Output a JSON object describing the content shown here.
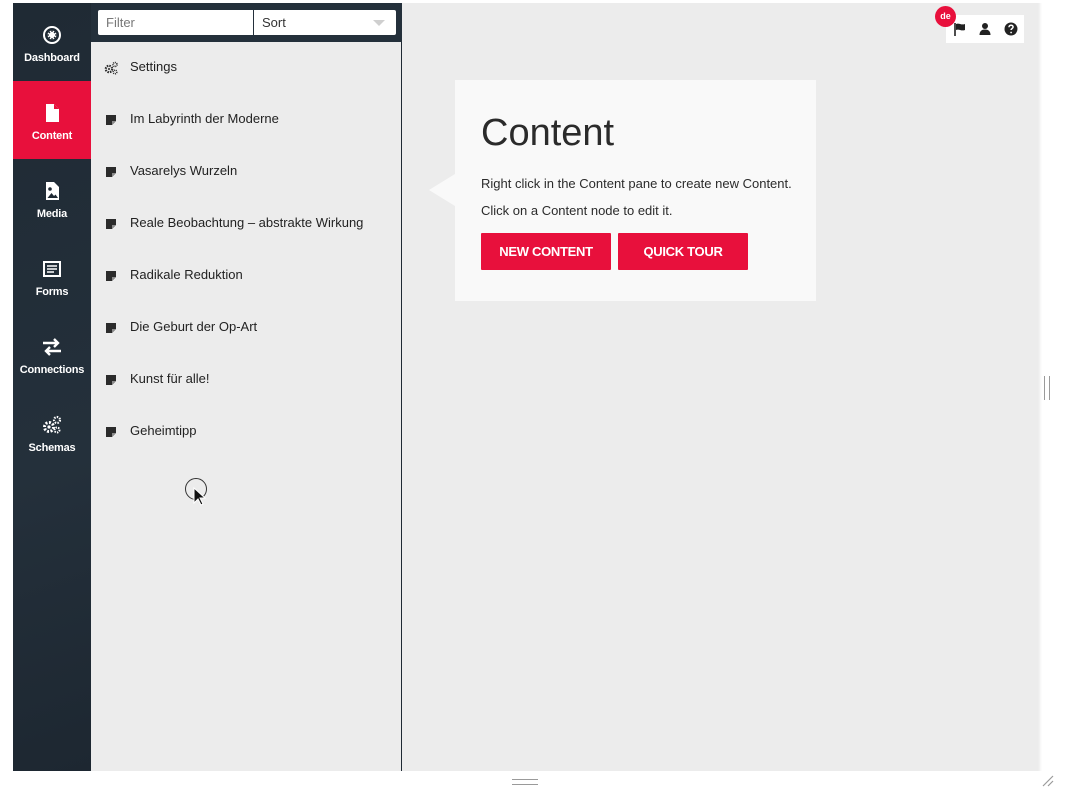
{
  "sidebar": {
    "items": [
      {
        "label": "Dashboard",
        "icon": "dashboard-icon"
      },
      {
        "label": "Content",
        "icon": "file-icon",
        "active": true
      },
      {
        "label": "Media",
        "icon": "image-icon"
      },
      {
        "label": "Forms",
        "icon": "form-icon"
      },
      {
        "label": "Connections",
        "icon": "arrows-icon"
      },
      {
        "label": "Schemas",
        "icon": "gears-icon"
      }
    ]
  },
  "tree": {
    "filter_placeholder": "Filter",
    "sort_label": "Sort",
    "items": [
      {
        "label": "Settings",
        "icon": "gears-icon"
      },
      {
        "label": "Im Labyrinth der Moderne",
        "icon": "note-icon"
      },
      {
        "label": "Vasarelys Wurzeln",
        "icon": "note-icon"
      },
      {
        "label": "Reale Beobachtung – abstrakte Wirkung",
        "icon": "note-icon"
      },
      {
        "label": "Radikale Reduktion",
        "icon": "note-icon"
      },
      {
        "label": "Die Geburt der Op-Art",
        "icon": "note-icon"
      },
      {
        "label": "Kunst für alle!",
        "icon": "note-icon"
      },
      {
        "label": "Geheimtipp",
        "icon": "note-icon"
      }
    ]
  },
  "topbar": {
    "language": "de",
    "icons": [
      "flag-icon",
      "user-icon",
      "help-icon"
    ]
  },
  "card": {
    "title": "Content",
    "line1": "Right click in the Content pane to create new Content.",
    "line2": "Click on a Content node to edit it.",
    "new_content_label": "NEW CONTENT",
    "quick_tour_label": "QUICK TOUR"
  },
  "colors": {
    "accent": "#e8103c",
    "sidebar": "#1f2a34",
    "background": "#ececec"
  }
}
